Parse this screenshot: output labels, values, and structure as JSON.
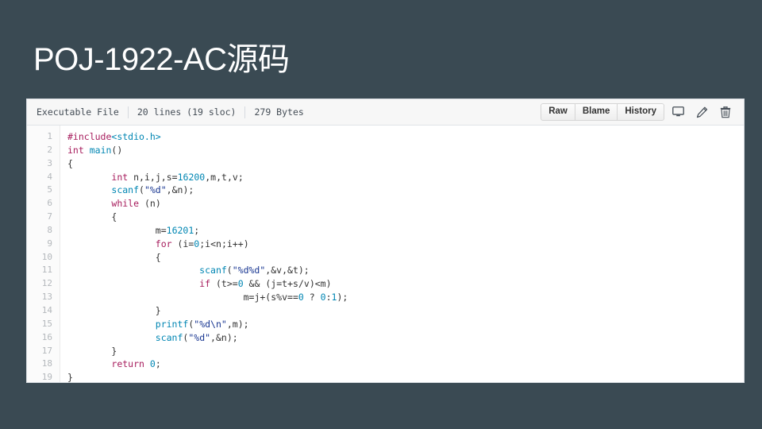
{
  "slide": {
    "title": "POJ-1922-AC源码",
    "background_color": "#3a4a53",
    "title_color": "#ffffff"
  },
  "code_card": {
    "header": {
      "meta": [
        "Executable File",
        "20 lines (19 sloc)",
        "279 Bytes"
      ],
      "buttons": [
        "Raw",
        "Blame",
        "History"
      ],
      "icons": [
        "desktop-icon",
        "pencil-icon",
        "trash-icon"
      ]
    },
    "line_numbers": [
      "1",
      "2",
      "3",
      "4",
      "5",
      "6",
      "7",
      "8",
      "9",
      "10",
      "11",
      "12",
      "13",
      "14",
      "15",
      "16",
      "17",
      "18",
      "19"
    ],
    "lines": [
      "#include<stdio.h>",
      "int main()",
      "{",
      "        int n,i,j,s=16200,m,t,v;",
      "        scanf(\"%d\",&n);",
      "        while (n)",
      "        {",
      "                m=16201;",
      "                for (i=0;i<n;i++)",
      "                {",
      "                        scanf(\"%d%d\",&v,&t);",
      "                        if (t>=0 && (j=t+s/v)<m)",
      "                                m=j+(s%v==0 ? 0:1);",
      "                }",
      "                printf(\"%d\\n\",m);",
      "                scanf(\"%d\",&n);",
      "        }",
      "        return 0;",
      "}"
    ],
    "syntax_colors": {
      "keyword": "#a71d5d",
      "string": "#183691",
      "number": "#0086b3",
      "function": "#0086b3",
      "plain": "#333333",
      "line_number": "#b4b8bc"
    }
  }
}
